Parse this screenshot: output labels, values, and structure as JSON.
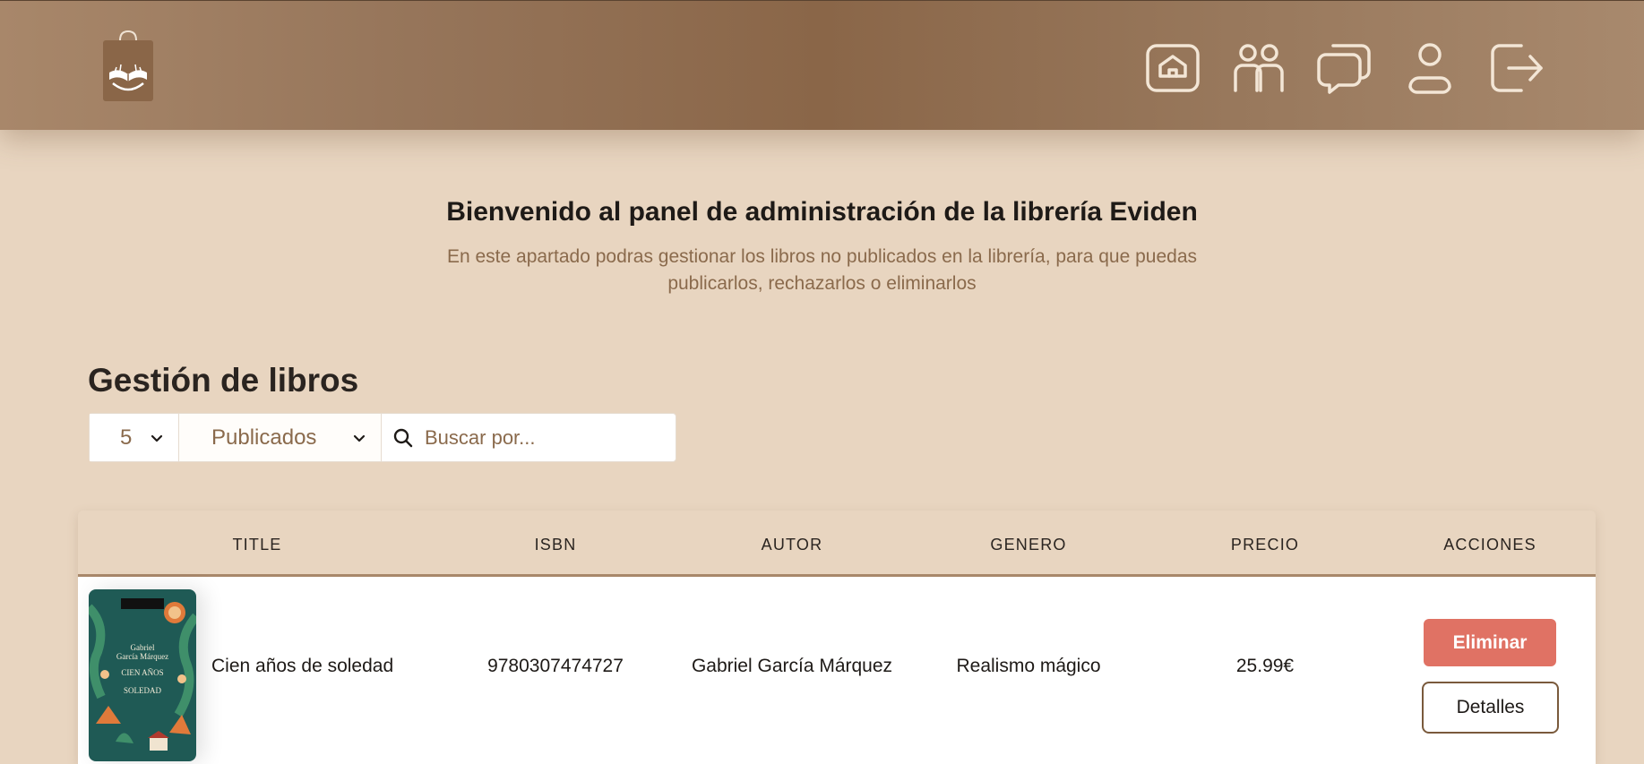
{
  "header": {
    "title": "Bienvenido al panel de administración de la librería Eviden",
    "subtitle": "En este apartado podras gestionar los libros no publicados en la librería, para que puedas publicarlos, rechazarlos o eliminarlos"
  },
  "nav": {
    "icons": [
      "home-icon",
      "users-icon",
      "messages-icon",
      "user-icon",
      "logout-icon"
    ]
  },
  "section": {
    "title": "Gestión de libros"
  },
  "filters": {
    "page_size": "5",
    "status": "Publicados",
    "search_placeholder": "Buscar por..."
  },
  "table": {
    "headers": [
      "TITLE",
      "ISBN",
      "AUTOR",
      "GENERO",
      "PRECIO",
      "ACCIONES"
    ],
    "rows": [
      {
        "title": "Cien años de soledad",
        "isbn": "9780307474727",
        "autor": "Gabriel García Márquez",
        "genero": "Realismo mágico",
        "precio": "25.99€",
        "delete_label": "Eliminar",
        "details_label": "Detalles"
      }
    ]
  },
  "colors": {
    "accent": "#a8876a",
    "background": "#e8d5c0",
    "danger": "#e07264",
    "muted_text": "#8a6a4c"
  }
}
